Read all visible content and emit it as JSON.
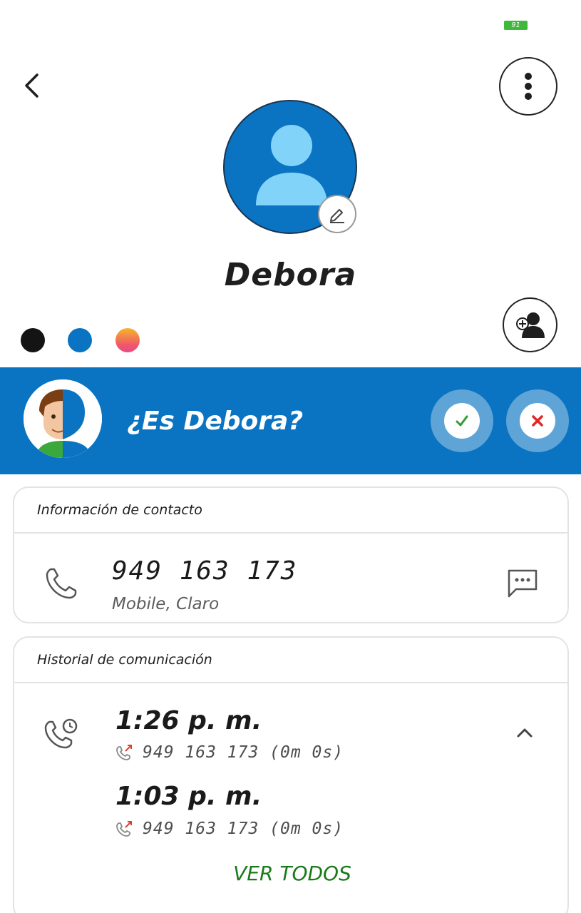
{
  "status_bar": {
    "battery": "91"
  },
  "contact": {
    "name": "Debora",
    "color_options": [
      "#141414",
      "#0a74c2",
      "gradient-pink-orange"
    ]
  },
  "banner": {
    "question": "¿Es Debora?",
    "confirm_icon": "check-icon",
    "reject_icon": "close-icon"
  },
  "contact_info": {
    "header": "Información de contacto",
    "phone": "949 163 173",
    "phone_detail": "Mobile, Claro"
  },
  "history": {
    "header": "Historial de comunicación",
    "calls": [
      {
        "time": "1:26 p. m.",
        "detail": "949 163 173 (0m 0s)"
      },
      {
        "time": "1:03 p. m.",
        "detail": "949 163 173 (0m 0s)"
      }
    ],
    "see_all_label": "VER TODOS"
  },
  "colors": {
    "brand_blue": "#0a74c2",
    "accent_green": "#1a7a1a",
    "confirm_green": "#2e9e2e",
    "reject_red": "#e02626"
  }
}
